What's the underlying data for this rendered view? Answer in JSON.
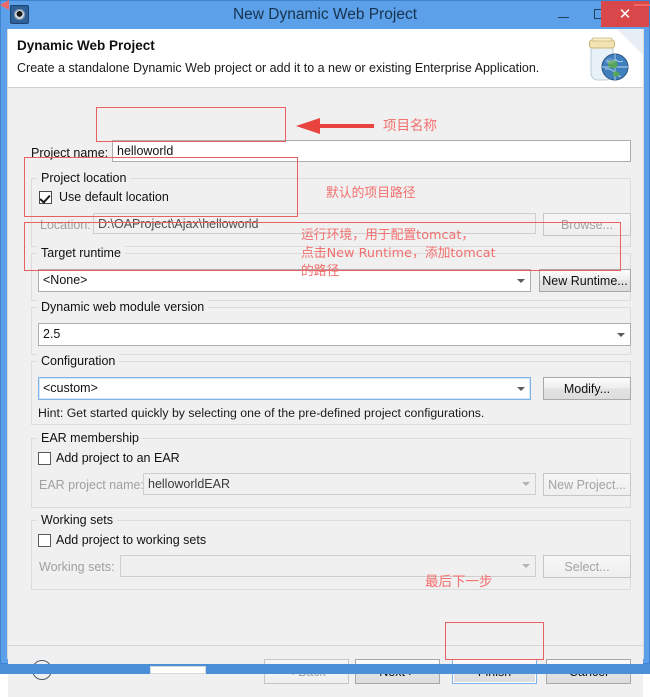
{
  "window": {
    "title": "New Dynamic Web Project",
    "icon": "eclipse-gear-icon",
    "minimize_label": "–",
    "maximize_label": "□",
    "close_label": "✕"
  },
  "banner": {
    "title": "Dynamic Web Project",
    "description": "Create a standalone Dynamic Web project or add it to a new or existing Enterprise Application.",
    "icon": "jar-globe-icon"
  },
  "form": {
    "project_name": {
      "label": "Project name:",
      "value": "helloworld"
    },
    "project_location": {
      "group_title": "Project location",
      "use_default_label": "Use default location",
      "use_default_checked": true,
      "location_label": "Location:",
      "location_value": "D:\\OAProject\\Ajax\\helloworld",
      "browse_label": "Browse..."
    },
    "target_runtime": {
      "group_title": "Target runtime",
      "value": "<None>",
      "new_runtime_label": "New Runtime..."
    },
    "module_version": {
      "group_title": "Dynamic web module version",
      "value": "2.5"
    },
    "configuration": {
      "group_title": "Configuration",
      "value": "<custom>",
      "modify_label": "Modify...",
      "hint": "Hint: Get started quickly by selecting one of the pre-defined project configurations."
    },
    "ear_membership": {
      "group_title": "EAR membership",
      "add_to_ear_label": "Add project to an EAR",
      "add_to_ear_checked": false,
      "ear_project_name_label": "EAR project name:",
      "ear_project_name_value": "helloworldEAR",
      "new_project_label": "New Project..."
    },
    "working_sets": {
      "group_title": "Working sets",
      "add_to_working_sets_label": "Add project to working sets",
      "add_to_working_sets_checked": false,
      "working_sets_label": "Working sets:",
      "working_sets_value": "",
      "select_label": "Select..."
    }
  },
  "buttons": {
    "help": "?",
    "back": "< Back",
    "next": "Next >",
    "finish": "Finish",
    "cancel": "Cancel"
  },
  "annotations": {
    "project_name": "项目名称",
    "default_path": "默认的项目路径",
    "target_runtime_line1": "运行环境，用于配置tomcat，",
    "target_runtime_line2": "点击New Runtime，添加tomcat",
    "target_runtime_line3": "的路径",
    "finish_note": "最后下一步"
  },
  "colors": {
    "titlebar": "#5ba0e8",
    "close_button": "#d8484a",
    "annotation_red": "#f2706e",
    "box_red": "#e8605f",
    "dialog_bg": "#f0f0f0"
  }
}
